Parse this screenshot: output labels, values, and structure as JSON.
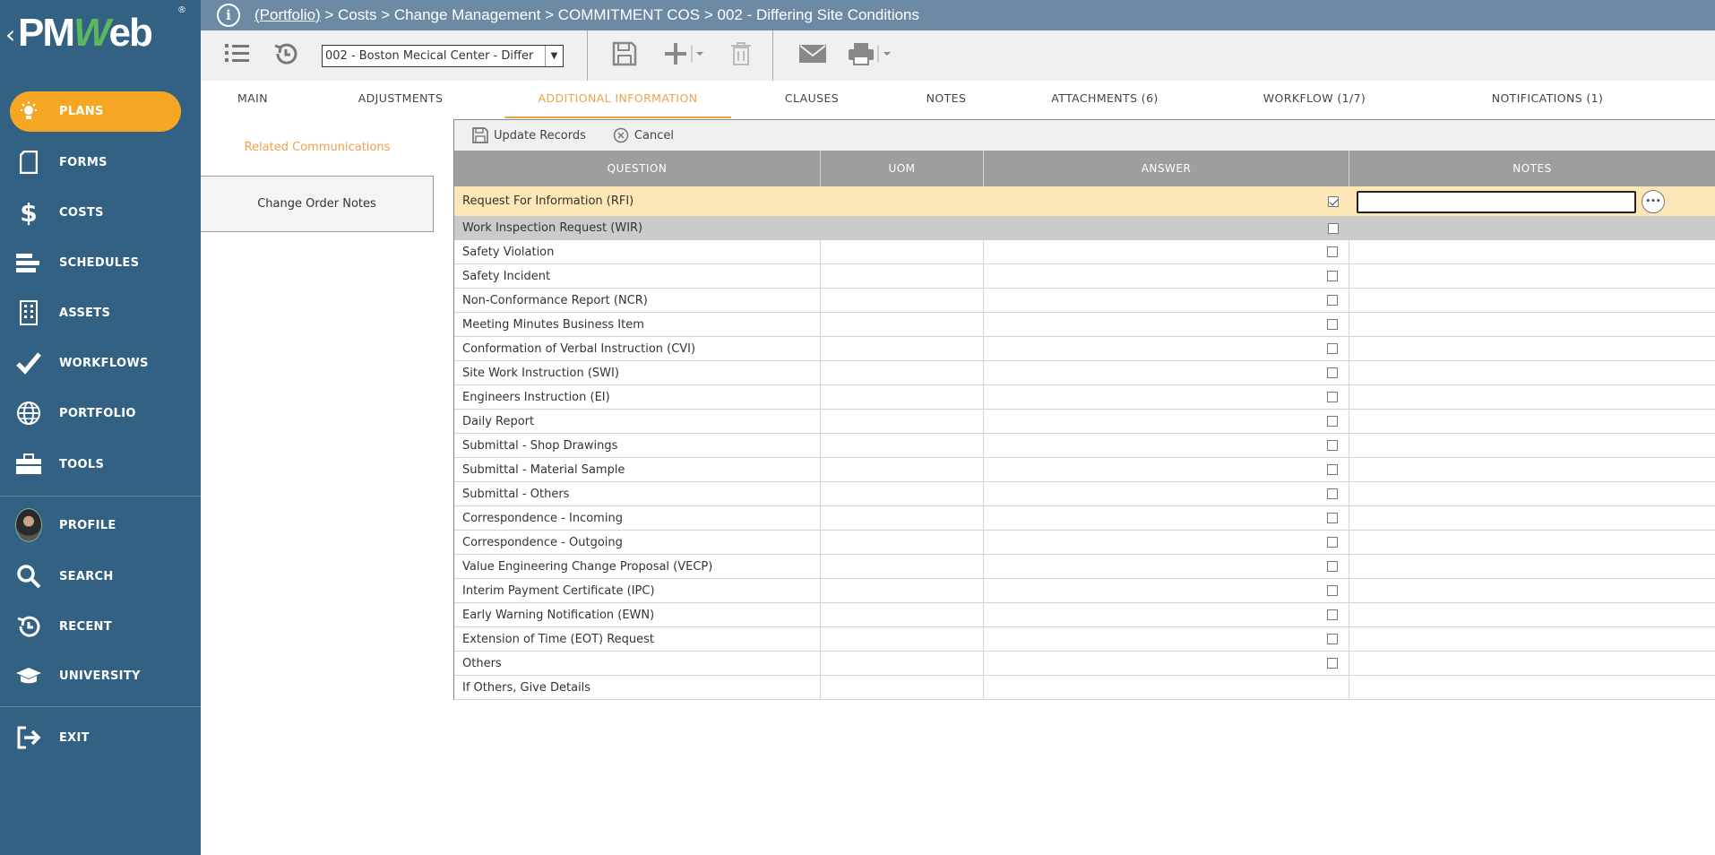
{
  "logo": {
    "text_a": "PM",
    "text_w": "W",
    "text_b": "eb",
    "reg": "®",
    "back": "‹"
  },
  "sidebar": {
    "items": [
      {
        "label": "PLANS",
        "icon": "lightbulb-icon",
        "active": true
      },
      {
        "label": "FORMS",
        "icon": "document-icon"
      },
      {
        "label": "COSTS",
        "icon": "dollar-icon"
      },
      {
        "label": "SCHEDULES",
        "icon": "schedule-bars-icon"
      },
      {
        "label": "ASSETS",
        "icon": "building-icon"
      },
      {
        "label": "WORKFLOWS",
        "icon": "checkmark-icon"
      },
      {
        "label": "PORTFOLIO",
        "icon": "globe-icon"
      },
      {
        "label": "TOOLS",
        "icon": "toolbox-icon"
      },
      {
        "label": "PROFILE",
        "icon": "avatar"
      },
      {
        "label": "SEARCH",
        "icon": "search-icon"
      },
      {
        "label": "RECENT",
        "icon": "history-icon"
      },
      {
        "label": "UNIVERSITY",
        "icon": "graduation-cap-icon"
      },
      {
        "label": "EXIT",
        "icon": "exit-icon"
      }
    ],
    "accent": "#f5a623",
    "background": "#336183"
  },
  "breadcrumb": {
    "portfolio_link": "(Portfolio)",
    "rest": " > Costs > Change Management > COMMITMENT COS > 002 - Differing Site Conditions"
  },
  "toolbar": {
    "record_select_value": "002 - Boston Mecical Center - Differ",
    "icons": [
      "list-icon",
      "history-icon",
      "save-icon",
      "add-icon",
      "delete-icon",
      "email-icon",
      "print-icon"
    ]
  },
  "tabs": [
    {
      "label": "MAIN"
    },
    {
      "label": "ADJUSTMENTS"
    },
    {
      "label": "ADDITIONAL INFORMATION",
      "active": true
    },
    {
      "label": "CLAUSES"
    },
    {
      "label": "NOTES"
    },
    {
      "label": "ATTACHMENTS (6)"
    },
    {
      "label": "WORKFLOW (1/7)"
    },
    {
      "label": "NOTIFICATIONS (1)"
    }
  ],
  "subnav": {
    "related": "Related Communications",
    "change_order_notes": "Change Order Notes"
  },
  "grid": {
    "toolbar": {
      "update": "Update Records",
      "cancel": "Cancel"
    },
    "headers": {
      "question": "QUESTION",
      "uom": "UOM",
      "answer": "ANSWER",
      "notes": "NOTES"
    },
    "rows": [
      {
        "question": "Request For Information (RFI)",
        "checkbox": true,
        "checked": true,
        "state": "editing"
      },
      {
        "question": "Work Inspection Request (WIR)",
        "checkbox": true,
        "checked": false,
        "state": "selected"
      },
      {
        "question": "Safety Violation",
        "checkbox": true,
        "checked": false
      },
      {
        "question": "Safety Incident",
        "checkbox": true,
        "checked": false
      },
      {
        "question": "Non-Conformance Report (NCR)",
        "checkbox": true,
        "checked": false
      },
      {
        "question": "Meeting Minutes Business Item",
        "checkbox": true,
        "checked": false
      },
      {
        "question": "Conformation of Verbal Instruction (CVI)",
        "checkbox": true,
        "checked": false
      },
      {
        "question": "Site Work Instruction (SWI)",
        "checkbox": true,
        "checked": false
      },
      {
        "question": "Engineers Instruction (EI)",
        "checkbox": true,
        "checked": false
      },
      {
        "question": "Daily Report",
        "checkbox": true,
        "checked": false
      },
      {
        "question": "Submittal - Shop Drawings",
        "checkbox": true,
        "checked": false
      },
      {
        "question": "Submittal - Material Sample",
        "checkbox": true,
        "checked": false
      },
      {
        "question": "Submittal - Others",
        "checkbox": true,
        "checked": false
      },
      {
        "question": "Correspondence - Incoming",
        "checkbox": true,
        "checked": false
      },
      {
        "question": "Correspondence - Outgoing",
        "checkbox": true,
        "checked": false
      },
      {
        "question": "Value Engineering Change Proposal (VECP)",
        "checkbox": true,
        "checked": false
      },
      {
        "question": "Interim Payment Certificate (IPC)",
        "checkbox": true,
        "checked": false
      },
      {
        "question": "Early Warning Notification (EWN)",
        "checkbox": true,
        "checked": false
      },
      {
        "question": "Extension of Time (EOT) Request",
        "checkbox": true,
        "checked": false
      },
      {
        "question": "Others",
        "checkbox": true,
        "checked": false
      },
      {
        "question": "If Others, Give Details",
        "checkbox": false,
        "checked": false
      }
    ],
    "colors": {
      "header": "#9e9e9e",
      "editing_row": "#fde7b6",
      "selected_row": "#cbcbcb"
    }
  }
}
